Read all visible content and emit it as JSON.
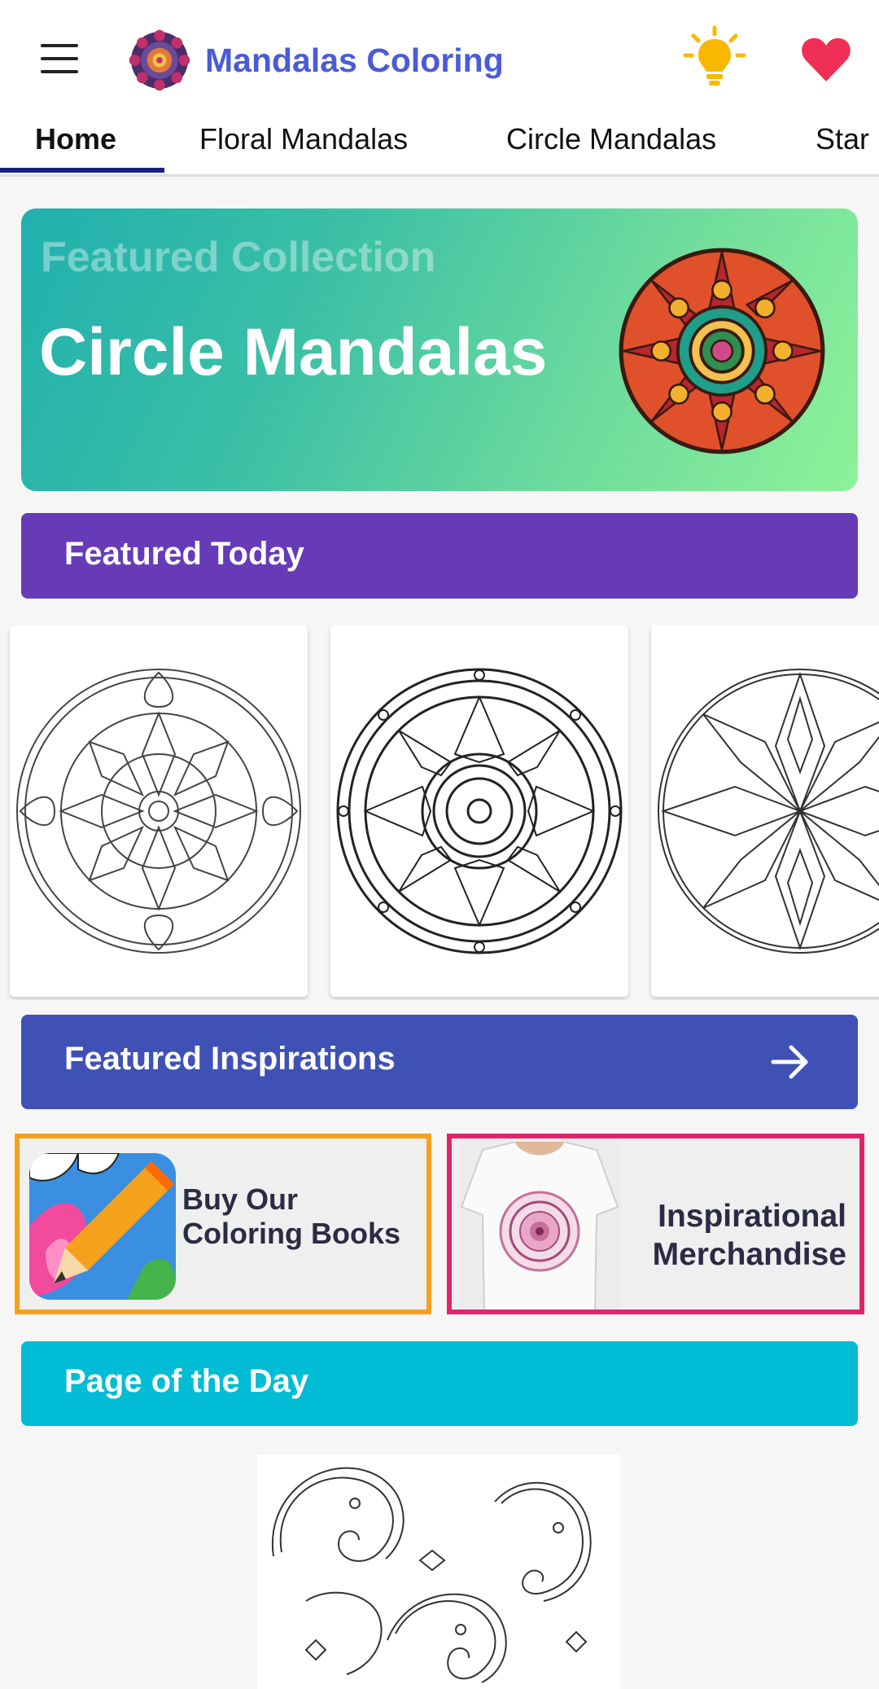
{
  "app": {
    "title": "Mandalas Coloring",
    "icons": [
      "menu-icon",
      "mandala-logo-icon",
      "lightbulb-icon",
      "heart-icon"
    ],
    "colors": {
      "title": "#4a5bd6",
      "bulb": "#f9b800",
      "heart": "#ef2f53"
    }
  },
  "tabs": [
    {
      "label": "Home",
      "active": true
    },
    {
      "label": "Floral Mandalas"
    },
    {
      "label": "Circle Mandalas"
    },
    {
      "label": "Star"
    }
  ],
  "hero": {
    "subtitle": "Featured Collection",
    "title": "Circle Mandalas"
  },
  "sections": {
    "featured_today": {
      "label": "Featured Today",
      "color": "#673ab7"
    },
    "featured_inspirations": {
      "label": "Featured Inspirations",
      "color": "#3f51b5",
      "icon": "arrow-right-icon"
    },
    "page_of_the_day": {
      "label": "Page of the Day",
      "color": "#00bcd4"
    }
  },
  "promos": {
    "books": {
      "line1": "Buy Our",
      "line2": "Coloring Books",
      "border": "#f5a11c"
    },
    "merch": {
      "line1": "Inspirational",
      "line2": "Merchandise",
      "border": "#e0246c"
    }
  }
}
